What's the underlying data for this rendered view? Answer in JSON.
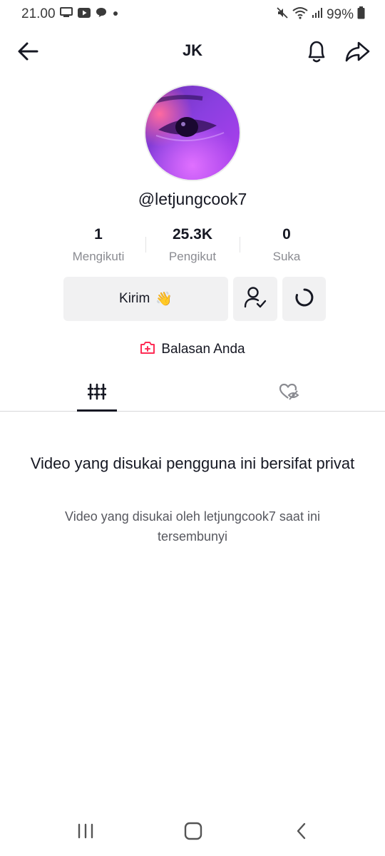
{
  "status_bar": {
    "time": "21.00",
    "battery": "99%"
  },
  "header": {
    "title": "JK"
  },
  "profile": {
    "username": "@letjungcook7",
    "stats": [
      {
        "value": "1",
        "label": "Mengikuti"
      },
      {
        "value": "25.3K",
        "label": "Pengikut"
      },
      {
        "value": "0",
        "label": "Suka"
      }
    ]
  },
  "actions": {
    "message_label": "Kirim",
    "message_emoji": "👋"
  },
  "replies_label": "Balasan Anda",
  "private_notice": {
    "title": "Video yang disukai pengguna ini bersifat privat",
    "description": "Video yang disukai oleh letjungcook7 saat ini tersembunyi"
  },
  "colors": {
    "accent_red": "#fe2c55",
    "text_primary": "#161823",
    "text_secondary": "#8a8b91",
    "button_bg": "#f1f1f2"
  }
}
